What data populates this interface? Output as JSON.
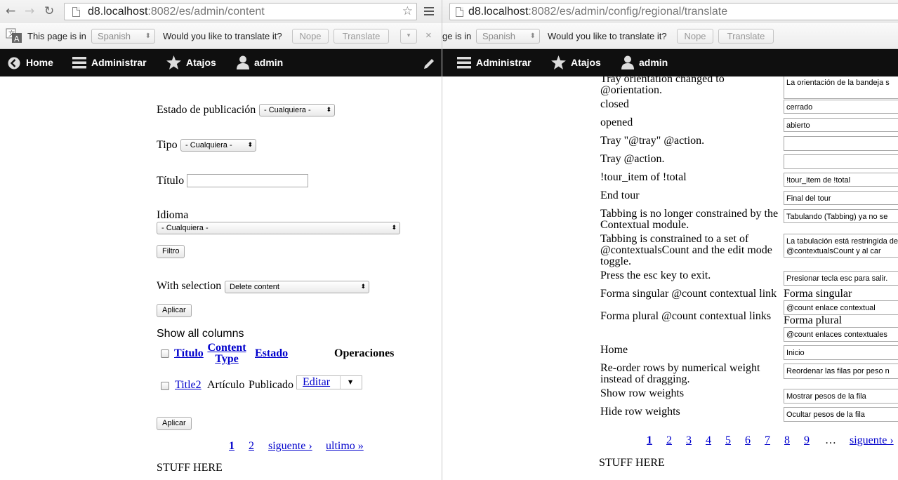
{
  "left": {
    "browser": {
      "host": "d8.localhost",
      "path": ":8082/es/admin/content"
    },
    "infobar": {
      "page_is_in": "This page is in",
      "language": "Spanish",
      "question": "Would you like to translate it?",
      "nope": "Nope",
      "translate": "Translate",
      "close": "×",
      "options": "▾"
    },
    "toolbar": {
      "home": "Home",
      "administrar": "Administrar",
      "atajos": "Atajos",
      "admin": "admin"
    },
    "filters": {
      "estado_label": "Estado de publicación",
      "estado_value": "- Cualquiera -",
      "tipo_label": "Tipo",
      "tipo_value": "- Cualquiera -",
      "titulo_label": "Título",
      "idioma_label": "Idioma",
      "idioma_value": "- Cualquiera -",
      "filtro_button": "Filtro"
    },
    "bulk": {
      "label": "With selection",
      "value": "Delete content",
      "apply": "Aplicar"
    },
    "table": {
      "show_all": "Show all columns",
      "headers": {
        "titulo": "Título",
        "content_type": "Content Type",
        "estado": "Estado",
        "operaciones": "Operaciones"
      },
      "rows": [
        {
          "title": "Title2",
          "type": "Artículo",
          "status": "Publicado",
          "op": "Editar"
        }
      ]
    },
    "apply_bottom": "Aplicar",
    "pager": {
      "p1": "1",
      "p2": "2",
      "next": "siguente ›",
      "last": "ultimo »"
    },
    "footer": "STUFF HERE"
  },
  "right": {
    "browser": {
      "host": "d8.localhost",
      "path": ":8082/es/admin/config/regional/translate"
    },
    "infobar": {
      "page_is_in": "ge is in",
      "language": "Spanish",
      "question": "Would you like to translate it?",
      "nope": "Nope",
      "translate": "Translate"
    },
    "toolbar": {
      "administrar": "Administrar",
      "atajos": "Atajos",
      "admin": "admin"
    },
    "rows": [
      {
        "source": "Tray orientation changed to @orientation.",
        "translation": "La orientación de la bandeja s"
      },
      {
        "source": "closed",
        "translation": "cerrado"
      },
      {
        "source": "opened",
        "translation": "abierto"
      },
      {
        "source": "Tray \"@tray\" @action.",
        "translation": ""
      },
      {
        "source": "Tray @action.",
        "translation": ""
      },
      {
        "source": "!tour_item of !total",
        "translation": "!tour_item de !total"
      },
      {
        "source": "End tour",
        "translation": "Final del tour"
      },
      {
        "source": "Tabbing is no longer constrained by the Contextual module.",
        "translation": "Tabulando (Tabbing) ya no se"
      },
      {
        "source": "Tabbing is constrained to a set of @contextualsCount and the edit mode toggle.",
        "translation": "La tabulación está restringida de @contextualsCount y al car"
      },
      {
        "source": "Press the esc key to exit.",
        "translation": "Presionar tecla esc para salir."
      },
      {
        "source": "Forma singular @count contextual link",
        "label": "Forma singular",
        "translation": "@count enlace contextual"
      },
      {
        "source": "Forma plural @count contextual links",
        "label": "Forma plural",
        "translation": "@count enlaces contextuales"
      },
      {
        "source": "Home",
        "translation": "Inicio"
      },
      {
        "source": "Re-order rows by numerical weight instead of dragging.",
        "translation": "Reordenar las filas por peso n"
      },
      {
        "source": "Show row weights",
        "translation": "Mostrar pesos de la fila"
      },
      {
        "source": "Hide row weights",
        "translation": "Ocultar pesos de la fila"
      }
    ],
    "pager": [
      "1",
      "2",
      "3",
      "4",
      "5",
      "6",
      "7",
      "8",
      "9",
      "…",
      "siguente ›"
    ],
    "footer": "STUFF HERE"
  }
}
